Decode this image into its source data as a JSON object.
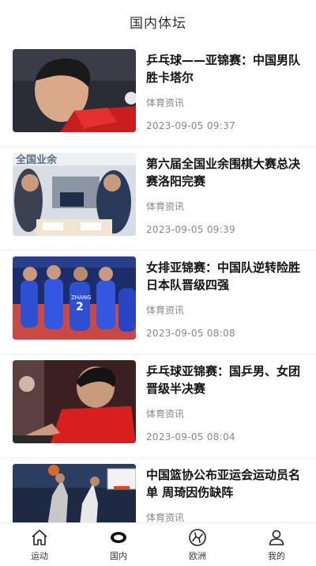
{
  "header": {
    "title": "国内体坛"
  },
  "articles": [
    {
      "title": "乒乓球——亚锦赛：中国男队胜卡塔尔",
      "category": "体育资讯",
      "time": "2023-09-05 09:37"
    },
    {
      "title": "第六届全国业余围棋大赛总决赛洛阳完赛",
      "category": "体育资讯",
      "time": "2023-09-05 09:39"
    },
    {
      "title": "女排亚锦赛：中国队逆转险胜日本队晋级四强",
      "category": "体育资讯",
      "time": "2023-09-05 08:08"
    },
    {
      "title": "乒乓球亚锦赛：国乒男、女团晋级半决赛",
      "category": "体育资讯",
      "time": "2023-09-05 08:04"
    },
    {
      "title": "中国篮协公布亚运会运动员名单 周琦因伤缺阵",
      "category": "体育资讯",
      "time": ""
    }
  ],
  "thumb_text": {
    "banner": "全国业余",
    "zhang": "ZHANG"
  },
  "tabs": [
    {
      "label": "运动",
      "icon": "home-icon"
    },
    {
      "label": "国内",
      "icon": "ring-icon"
    },
    {
      "label": "欧洲",
      "icon": "football-icon"
    },
    {
      "label": "我的",
      "icon": "person-icon"
    }
  ]
}
